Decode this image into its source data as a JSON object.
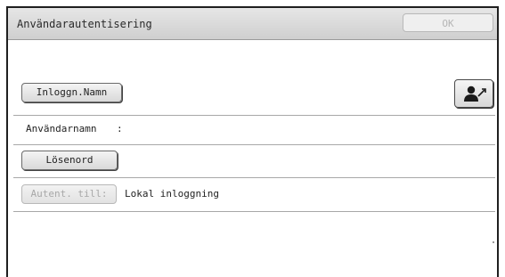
{
  "window": {
    "title": "Användarautentisering",
    "ok_label": "OK"
  },
  "login_name": {
    "button_label": "Inloggn.Namn"
  },
  "username": {
    "label": "Användarnamn",
    "separator": ":",
    "value": ""
  },
  "password": {
    "button_label": "Lösenord"
  },
  "auth_to": {
    "button_label": "Autent. till:",
    "value": "Lokal inloggning"
  },
  "icons": {
    "user_select": "user-select-icon"
  }
}
